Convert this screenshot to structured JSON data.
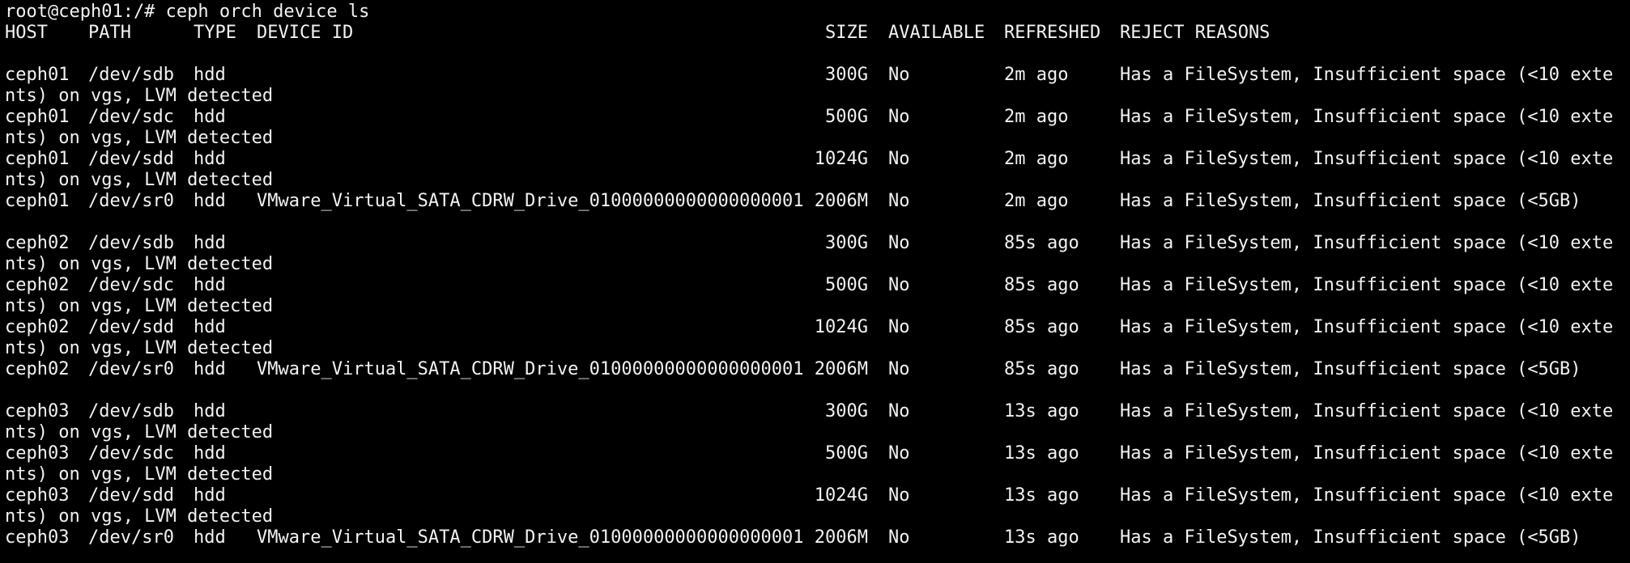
{
  "terminal": {
    "prompt_line": "root@ceph01:/# ceph orch device ls",
    "headers": {
      "host": "HOST",
      "path": "PATH",
      "type": "TYPE",
      "device_id": "DEVICE ID",
      "size": "SIZE",
      "available": "AVAILABLE",
      "refreshed": "REFRESHED",
      "reject_reasons": "REJECT REASONS"
    },
    "rows": [
      {
        "host": "ceph01",
        "path": "/dev/sdb",
        "type": "hdd",
        "device_id": "",
        "size": "300G",
        "available": "No",
        "refreshed": "2m ago",
        "reject": "Has a FileSystem, Insufficient space (<10 exte",
        "wrap": "nts) on vgs, LVM detected"
      },
      {
        "host": "ceph01",
        "path": "/dev/sdc",
        "type": "hdd",
        "device_id": "",
        "size": "500G",
        "available": "No",
        "refreshed": "2m ago",
        "reject": "Has a FileSystem, Insufficient space (<10 exte",
        "wrap": "nts) on vgs, LVM detected"
      },
      {
        "host": "ceph01",
        "path": "/dev/sdd",
        "type": "hdd",
        "device_id": "",
        "size": "1024G",
        "available": "No",
        "refreshed": "2m ago",
        "reject": "Has a FileSystem, Insufficient space (<10 exte",
        "wrap": "nts) on vgs, LVM detected"
      },
      {
        "host": "ceph01",
        "path": "/dev/sr0",
        "type": "hdd",
        "device_id": "VMware_Virtual_SATA_CDRW_Drive_01000000000000000001",
        "size": "2006M",
        "available": "No",
        "refreshed": "2m ago",
        "reject": "Has a FileSystem, Insufficient space (<5GB)",
        "wrap": ""
      },
      {
        "host": "ceph02",
        "path": "/dev/sdb",
        "type": "hdd",
        "device_id": "",
        "size": "300G",
        "available": "No",
        "refreshed": "85s ago",
        "reject": "Has a FileSystem, Insufficient space (<10 exte",
        "wrap": "nts) on vgs, LVM detected"
      },
      {
        "host": "ceph02",
        "path": "/dev/sdc",
        "type": "hdd",
        "device_id": "",
        "size": "500G",
        "available": "No",
        "refreshed": "85s ago",
        "reject": "Has a FileSystem, Insufficient space (<10 exte",
        "wrap": "nts) on vgs, LVM detected"
      },
      {
        "host": "ceph02",
        "path": "/dev/sdd",
        "type": "hdd",
        "device_id": "",
        "size": "1024G",
        "available": "No",
        "refreshed": "85s ago",
        "reject": "Has a FileSystem, Insufficient space (<10 exte",
        "wrap": "nts) on vgs, LVM detected"
      },
      {
        "host": "ceph02",
        "path": "/dev/sr0",
        "type": "hdd",
        "device_id": "VMware_Virtual_SATA_CDRW_Drive_01000000000000000001",
        "size": "2006M",
        "available": "No",
        "refreshed": "85s ago",
        "reject": "Has a FileSystem, Insufficient space (<5GB)",
        "wrap": ""
      },
      {
        "host": "ceph03",
        "path": "/dev/sdb",
        "type": "hdd",
        "device_id": "",
        "size": "300G",
        "available": "No",
        "refreshed": "13s ago",
        "reject": "Has a FileSystem, Insufficient space (<10 exte",
        "wrap": "nts) on vgs, LVM detected"
      },
      {
        "host": "ceph03",
        "path": "/dev/sdc",
        "type": "hdd",
        "device_id": "",
        "size": "500G",
        "available": "No",
        "refreshed": "13s ago",
        "reject": "Has a FileSystem, Insufficient space (<10 exte",
        "wrap": "nts) on vgs, LVM detected"
      },
      {
        "host": "ceph03",
        "path": "/dev/sdd",
        "type": "hdd",
        "device_id": "",
        "size": "1024G",
        "available": "No",
        "refreshed": "13s ago",
        "reject": "Has a FileSystem, Insufficient space (<10 exte",
        "wrap": "nts) on vgs, LVM detected"
      },
      {
        "host": "ceph03",
        "path": "/dev/sr0",
        "type": "hdd",
        "device_id": "VMware_Virtual_SATA_CDRW_Drive_01000000000000000001",
        "size": "2006M",
        "available": "No",
        "refreshed": "13s ago",
        "reject": "Has a FileSystem, Insufficient space (<5GB)",
        "wrap": ""
      }
    ],
    "colors": {
      "background": "#000000",
      "foreground": "#f2f2f2"
    }
  }
}
